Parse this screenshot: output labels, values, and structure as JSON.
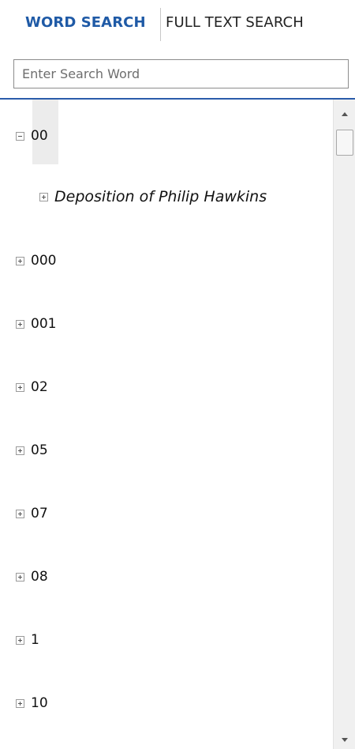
{
  "tabs": {
    "word_search": "WORD SEARCH",
    "full_text_search": "FULL TEXT SEARCH",
    "active": "word_search"
  },
  "search": {
    "placeholder": "Enter Search Word",
    "value": ""
  },
  "tree": {
    "nodes": [
      {
        "label": "00",
        "expanded": true,
        "level": 0,
        "selected": true
      },
      {
        "label": "Deposition of Philip Hawkins",
        "expanded": false,
        "level": 1,
        "italic": true
      },
      {
        "label": "000",
        "expanded": false,
        "level": 0
      },
      {
        "label": "001",
        "expanded": false,
        "level": 0
      },
      {
        "label": "02",
        "expanded": false,
        "level": 0
      },
      {
        "label": "05",
        "expanded": false,
        "level": 0
      },
      {
        "label": "07",
        "expanded": false,
        "level": 0
      },
      {
        "label": "08",
        "expanded": false,
        "level": 0
      },
      {
        "label": "1",
        "expanded": false,
        "level": 0
      },
      {
        "label": "10",
        "expanded": false,
        "level": 0
      }
    ]
  },
  "icons": {
    "expanded": "minus-box-icon",
    "collapsed": "plus-box-icon",
    "scroll_up": "caret-up-icon",
    "scroll_down": "caret-down-icon"
  },
  "colors": {
    "accent": "#1f5aa6",
    "rule": "#2a5caa",
    "selection": "#ececec"
  }
}
